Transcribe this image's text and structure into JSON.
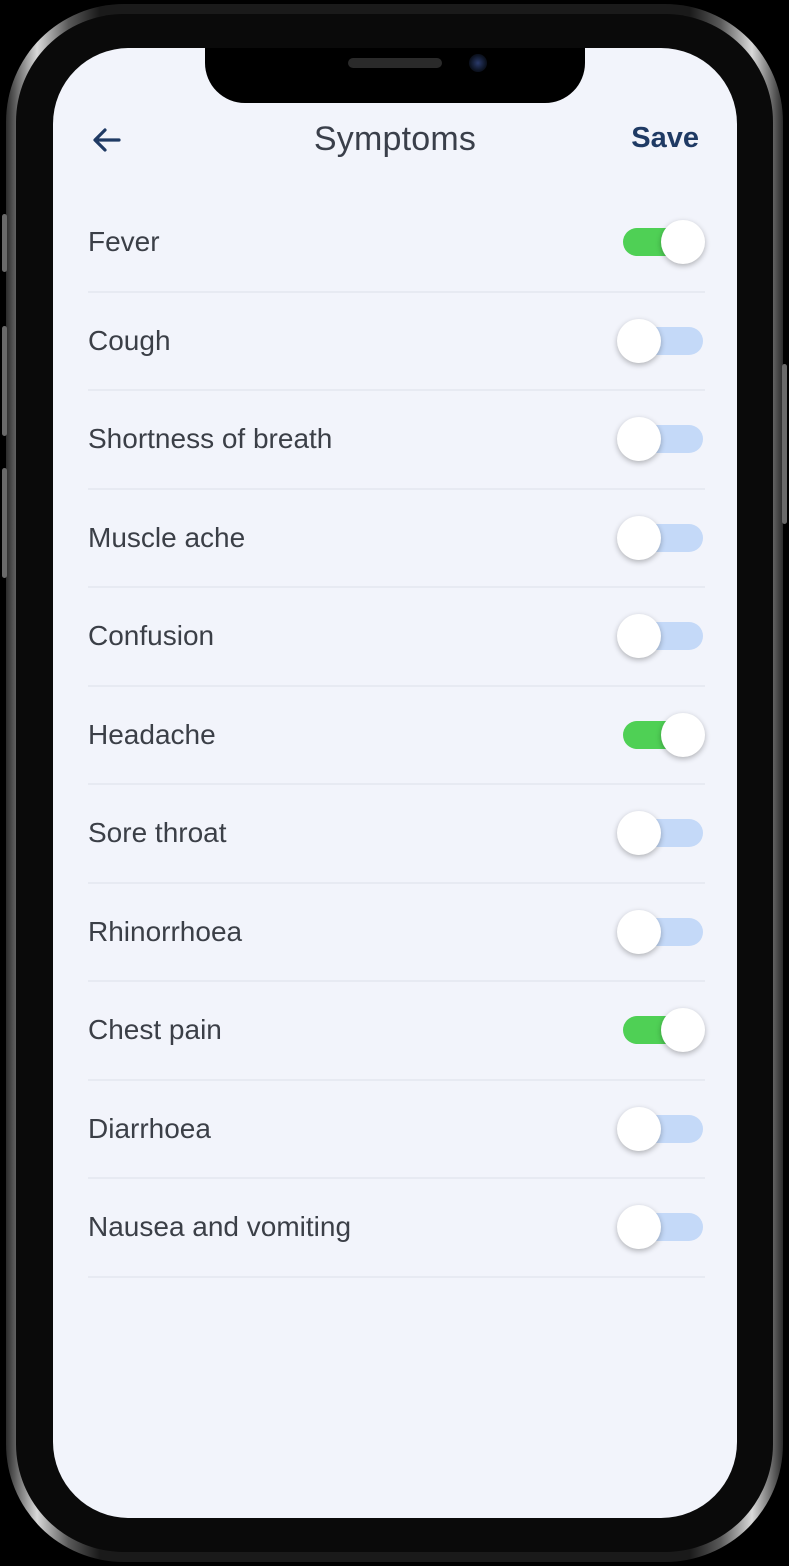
{
  "header": {
    "title": "Symptoms",
    "save_label": "Save",
    "back_icon": "arrow-left-icon"
  },
  "colors": {
    "background": "#f2f4fb",
    "accent": "#1f3a64",
    "toggle_on": "#4fd055",
    "toggle_off_track": "#c4d9f8"
  },
  "symptoms": [
    {
      "label": "Fever",
      "on": true
    },
    {
      "label": "Cough",
      "on": false
    },
    {
      "label": "Shortness of breath",
      "on": false
    },
    {
      "label": "Muscle ache",
      "on": false
    },
    {
      "label": "Confusion",
      "on": false
    },
    {
      "label": "Headache",
      "on": true
    },
    {
      "label": "Sore throat",
      "on": false
    },
    {
      "label": "Rhinorrhoea",
      "on": false
    },
    {
      "label": "Chest pain",
      "on": true
    },
    {
      "label": "Diarrhoea",
      "on": false
    },
    {
      "label": "Nausea and vomiting",
      "on": false
    }
  ]
}
